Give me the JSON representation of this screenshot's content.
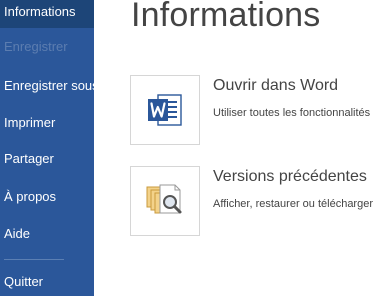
{
  "sidebar": {
    "items": [
      {
        "label": "Informations",
        "state": "active"
      },
      {
        "label": "Enregistrer",
        "state": "disabled"
      },
      {
        "label": "Enregistrer sous",
        "state": "normal"
      },
      {
        "label": "Imprimer",
        "state": "normal"
      },
      {
        "label": "Partager",
        "state": "normal"
      },
      {
        "label": "À propos",
        "state": "normal"
      },
      {
        "label": "Aide",
        "state": "normal"
      },
      {
        "label": "Quitter",
        "state": "normal"
      }
    ]
  },
  "main": {
    "title": "Informations",
    "actions": [
      {
        "icon": "word-document-icon",
        "title": "Ouvrir dans Word",
        "description": "Utiliser toutes les fonctionnalités"
      },
      {
        "icon": "version-history-icon",
        "title": "Versions précédentes",
        "description": "Afficher, restaurer ou télécharger"
      }
    ]
  },
  "colors": {
    "sidebar_background": "#2b579a",
    "sidebar_active": "#1d4578",
    "sidebar_disabled_text": "#5c7db0",
    "word_blue": "#2b579a"
  }
}
